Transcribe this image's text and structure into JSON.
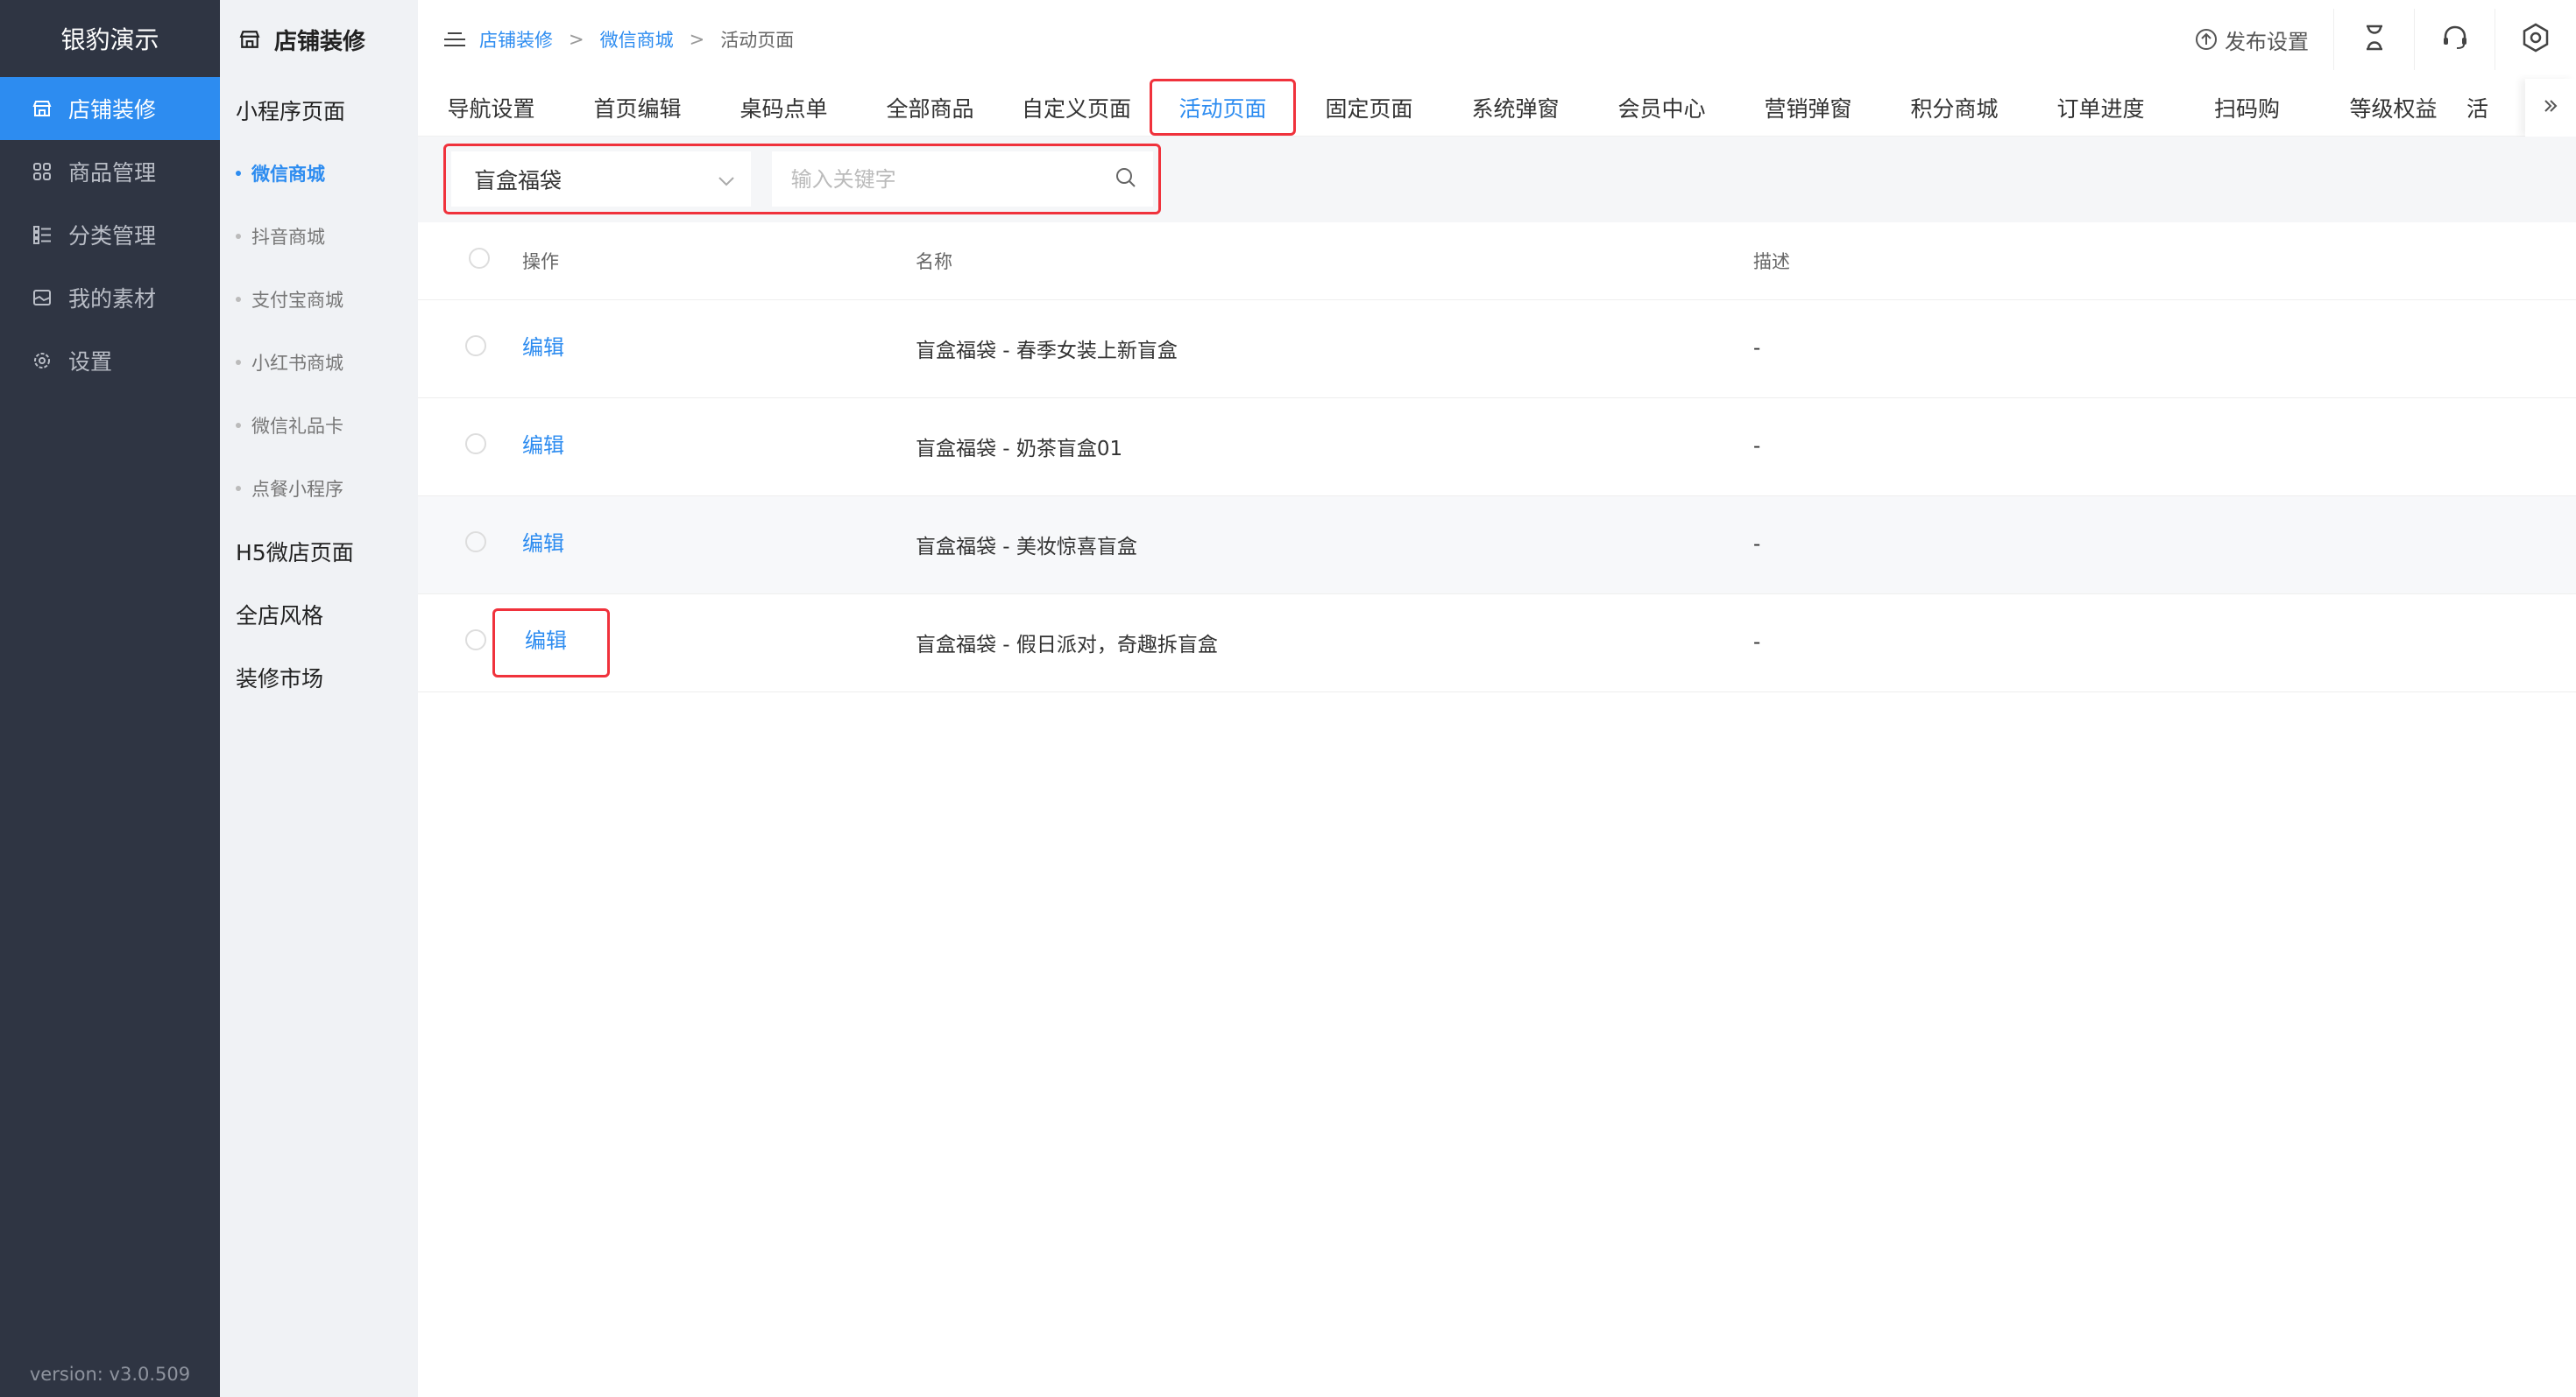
{
  "sidebar": {
    "brand": "银豹演示",
    "items": [
      {
        "label": "店铺装修",
        "icon": "store-icon",
        "active": true
      },
      {
        "label": "商品管理",
        "icon": "grid-icon",
        "active": false
      },
      {
        "label": "分类管理",
        "icon": "list-icon",
        "active": false
      },
      {
        "label": "我的素材",
        "icon": "image-icon",
        "active": false
      },
      {
        "label": "设置",
        "icon": "gear-icon",
        "active": false
      }
    ],
    "version": "version: v3.0.509"
  },
  "subbar": {
    "title": "店铺装修",
    "group1": "小程序页面",
    "items": [
      "微信商城",
      "抖音商城",
      "支付宝商城",
      "小红书商城",
      "微信礼品卡",
      "点餐小程序"
    ],
    "group2": "H5微店页面",
    "group3": "全店风格",
    "group4": "装修市场"
  },
  "breadcrumb": {
    "first": "店铺装修",
    "second": "微信商城",
    "current": "活动页面",
    "sep": ">"
  },
  "toolbar": {
    "publish": "发布设置"
  },
  "tabs": [
    "导航设置",
    "首页编辑",
    "桌码点单",
    "全部商品",
    "自定义页面",
    "活动页面",
    "固定页面",
    "系统弹窗",
    "会员中心",
    "营销弹窗",
    "积分商城",
    "订单进度",
    "扫码购",
    "等级权益",
    "活"
  ],
  "filter": {
    "select_value": "盲盒福袋",
    "search_placeholder": "输入关键字"
  },
  "table": {
    "headers": {
      "op": "操作",
      "name": "名称",
      "desc": "描述"
    },
    "edit_label": "编辑",
    "rows": [
      {
        "name": "盲盒福袋 - 春季女装上新盲盒",
        "desc": "-"
      },
      {
        "name": "盲盒福袋 - 奶茶盲盒01",
        "desc": "-"
      },
      {
        "name": "盲盒福袋 - 美妆惊喜盲盒",
        "desc": "-"
      },
      {
        "name": "盲盒福袋 - 假日派对，奇趣拆盲盒",
        "desc": "-"
      }
    ]
  },
  "colors": {
    "accent": "#2d8cf0",
    "highlight": "#f0323c",
    "sidebar": "#2f3543"
  }
}
